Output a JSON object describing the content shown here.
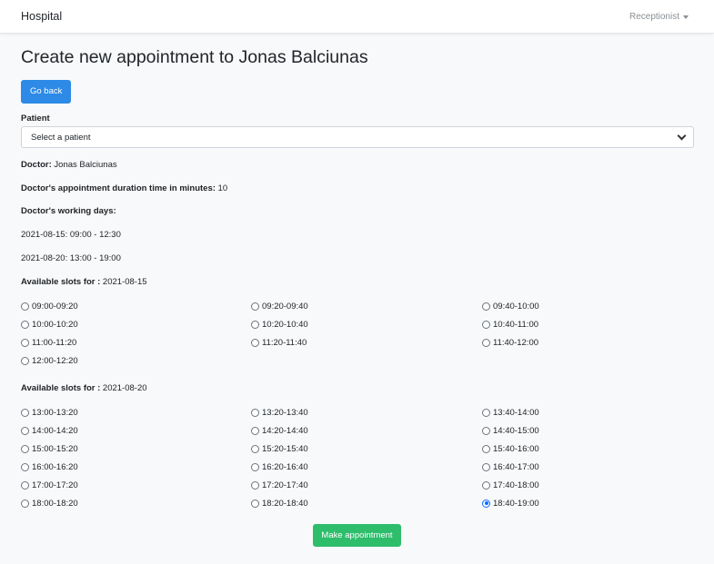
{
  "navbar": {
    "brand": "Hospital",
    "user_menu": "Receptionist"
  },
  "page": {
    "title": "Create new appointment to Jonas Balciunas",
    "back_button": "Go back",
    "patient_label": "Patient",
    "patient_placeholder": "Select a patient"
  },
  "doctor": {
    "doctor_label": "Doctor:",
    "doctor_name": "Jonas Balciunas",
    "duration_label": "Doctor's appointment duration time in minutes:",
    "duration_value": "10",
    "working_days_label": "Doctor's working days:",
    "working_days": [
      "2021-08-15: 09:00 - 12:30",
      "2021-08-20: 13:00 - 19:00"
    ]
  },
  "day1": {
    "label": "Available slots for :",
    "date": "2021-08-15",
    "slots": [
      "09:00-09:20",
      "09:20-09:40",
      "09:40-10:00",
      "10:00-10:20",
      "10:20-10:40",
      "10:40-11:00",
      "11:00-11:20",
      "11:20-11:40",
      "11:40-12:00",
      "12:00-12:20"
    ]
  },
  "day2": {
    "label": "Available slots for :",
    "date": "2021-08-20",
    "slots": [
      "13:00-13:20",
      "13:20-13:40",
      "13:40-14:00",
      "14:00-14:20",
      "14:20-14:40",
      "14:40-15:00",
      "15:00-15:20",
      "15:20-15:40",
      "15:40-16:00",
      "16:00-16:20",
      "16:20-16:40",
      "16:40-17:00",
      "17:00-17:20",
      "17:20-17:40",
      "17:40-18:00",
      "18:00-18:20",
      "18:20-18:40",
      "18:40-19:00"
    ],
    "selected": "18:40-19:00"
  },
  "submit_button": "Make appointment",
  "colors": {
    "primary": "#2d8ae6",
    "success": "#2ebd6b",
    "radio_checked": "#0d6efd"
  }
}
